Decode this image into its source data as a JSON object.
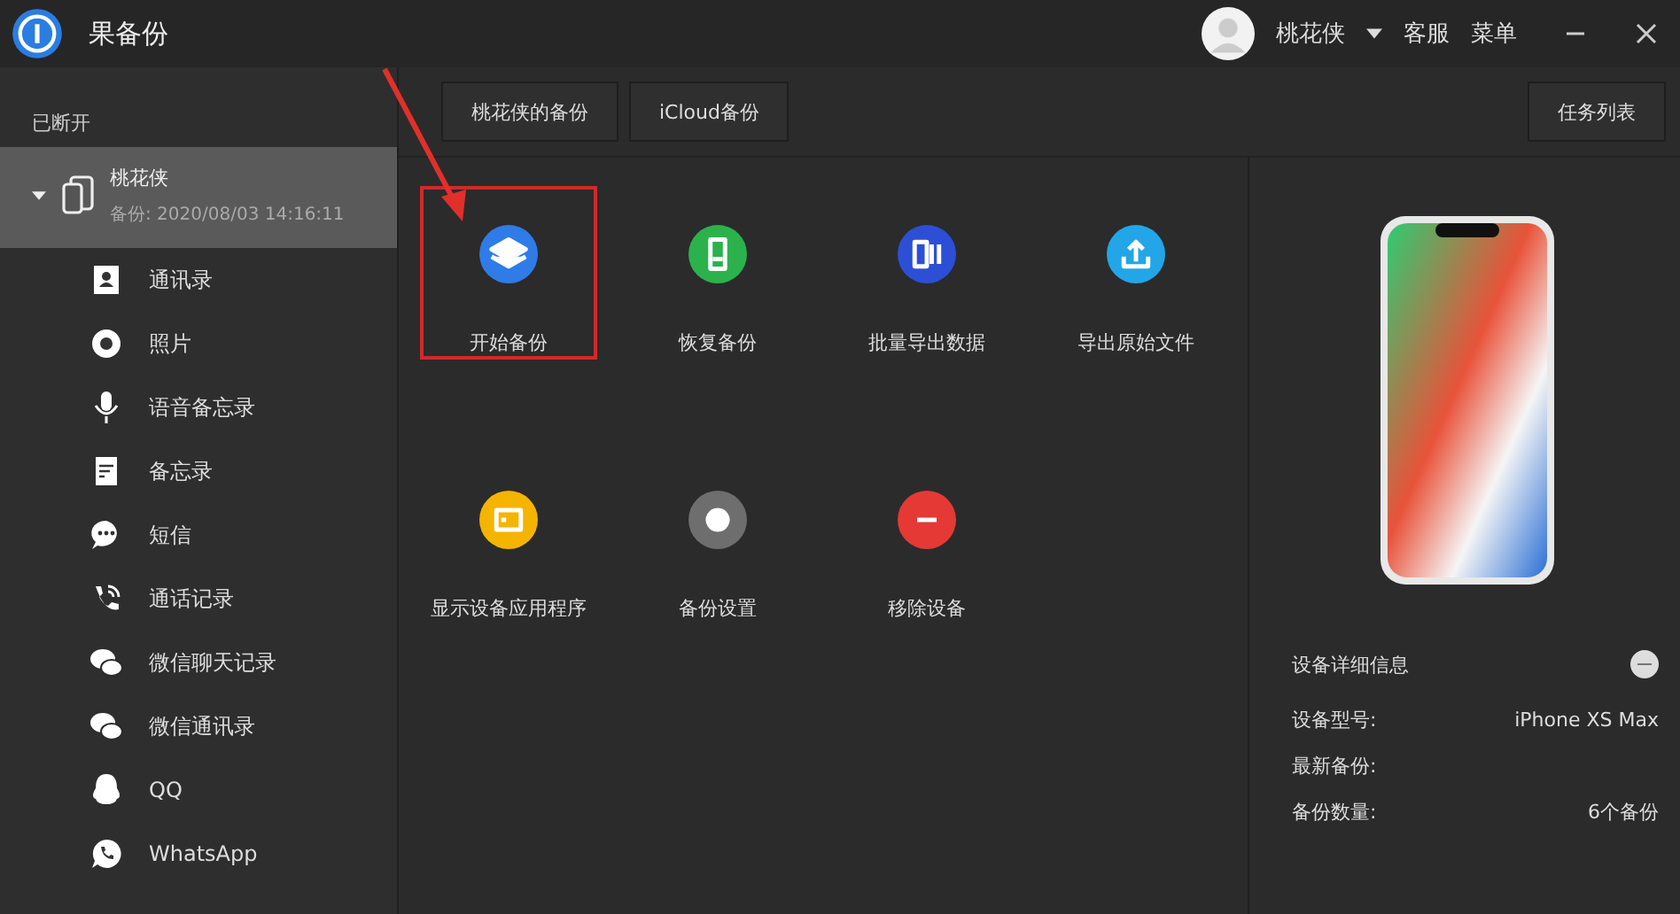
{
  "window": {
    "title": "果备份"
  },
  "user": {
    "name": "桃花侠"
  },
  "header_links": [
    "客服",
    "菜单"
  ],
  "sidebar": {
    "status": "已断开",
    "device": {
      "name": "桃花侠",
      "backup_time": "备份: 2020/08/03 14:16:11",
      "expanded": true,
      "selected": true
    },
    "items": [
      {
        "kind": "contacts",
        "label": "通讯录"
      },
      {
        "kind": "photos",
        "label": "照片"
      },
      {
        "kind": "voice",
        "label": "语音备忘录"
      },
      {
        "kind": "notes",
        "label": "备忘录"
      },
      {
        "kind": "sms",
        "label": "短信"
      },
      {
        "kind": "calls",
        "label": "通话记录"
      },
      {
        "kind": "wechat",
        "label": "微信聊天记录"
      },
      {
        "kind": "wechat",
        "label": "微信通讯录"
      },
      {
        "kind": "qq",
        "label": "QQ"
      },
      {
        "kind": "whatsapp",
        "label": "WhatsApp"
      }
    ]
  },
  "tabs": [
    {
      "label": "桃花侠的备份"
    },
    {
      "label": "iCloud备份"
    }
  ],
  "task_list_button": "任务列表",
  "actions": [
    {
      "kind": "backup",
      "label": "开始备份",
      "color": "#2f7be8",
      "highlighted": true
    },
    {
      "kind": "restore",
      "label": "恢复备份",
      "color": "#2bb24c",
      "highlighted": false
    },
    {
      "kind": "export",
      "label": "批量导出数据",
      "color": "#2c4fd6",
      "highlighted": false
    },
    {
      "kind": "download",
      "label": "导出原始文件",
      "color": "#22a6e8",
      "highlighted": false
    },
    {
      "kind": "screen",
      "label": "显示设备应用程序",
      "color": "#f5b400",
      "highlighted": false
    },
    {
      "kind": "settings",
      "label": "备份设置",
      "color": "#6e6e6e",
      "highlighted": false
    },
    {
      "kind": "remove",
      "label": "移除设备",
      "color": "#e53935",
      "highlighted": false
    }
  ],
  "device_info": {
    "title": "设备详细信息",
    "rows": [
      {
        "label": "设备型号:",
        "value": "iPhone XS Max"
      },
      {
        "label": "最新备份:"
      },
      {
        "label": "备份数量:",
        "value": "6个备份"
      }
    ]
  }
}
